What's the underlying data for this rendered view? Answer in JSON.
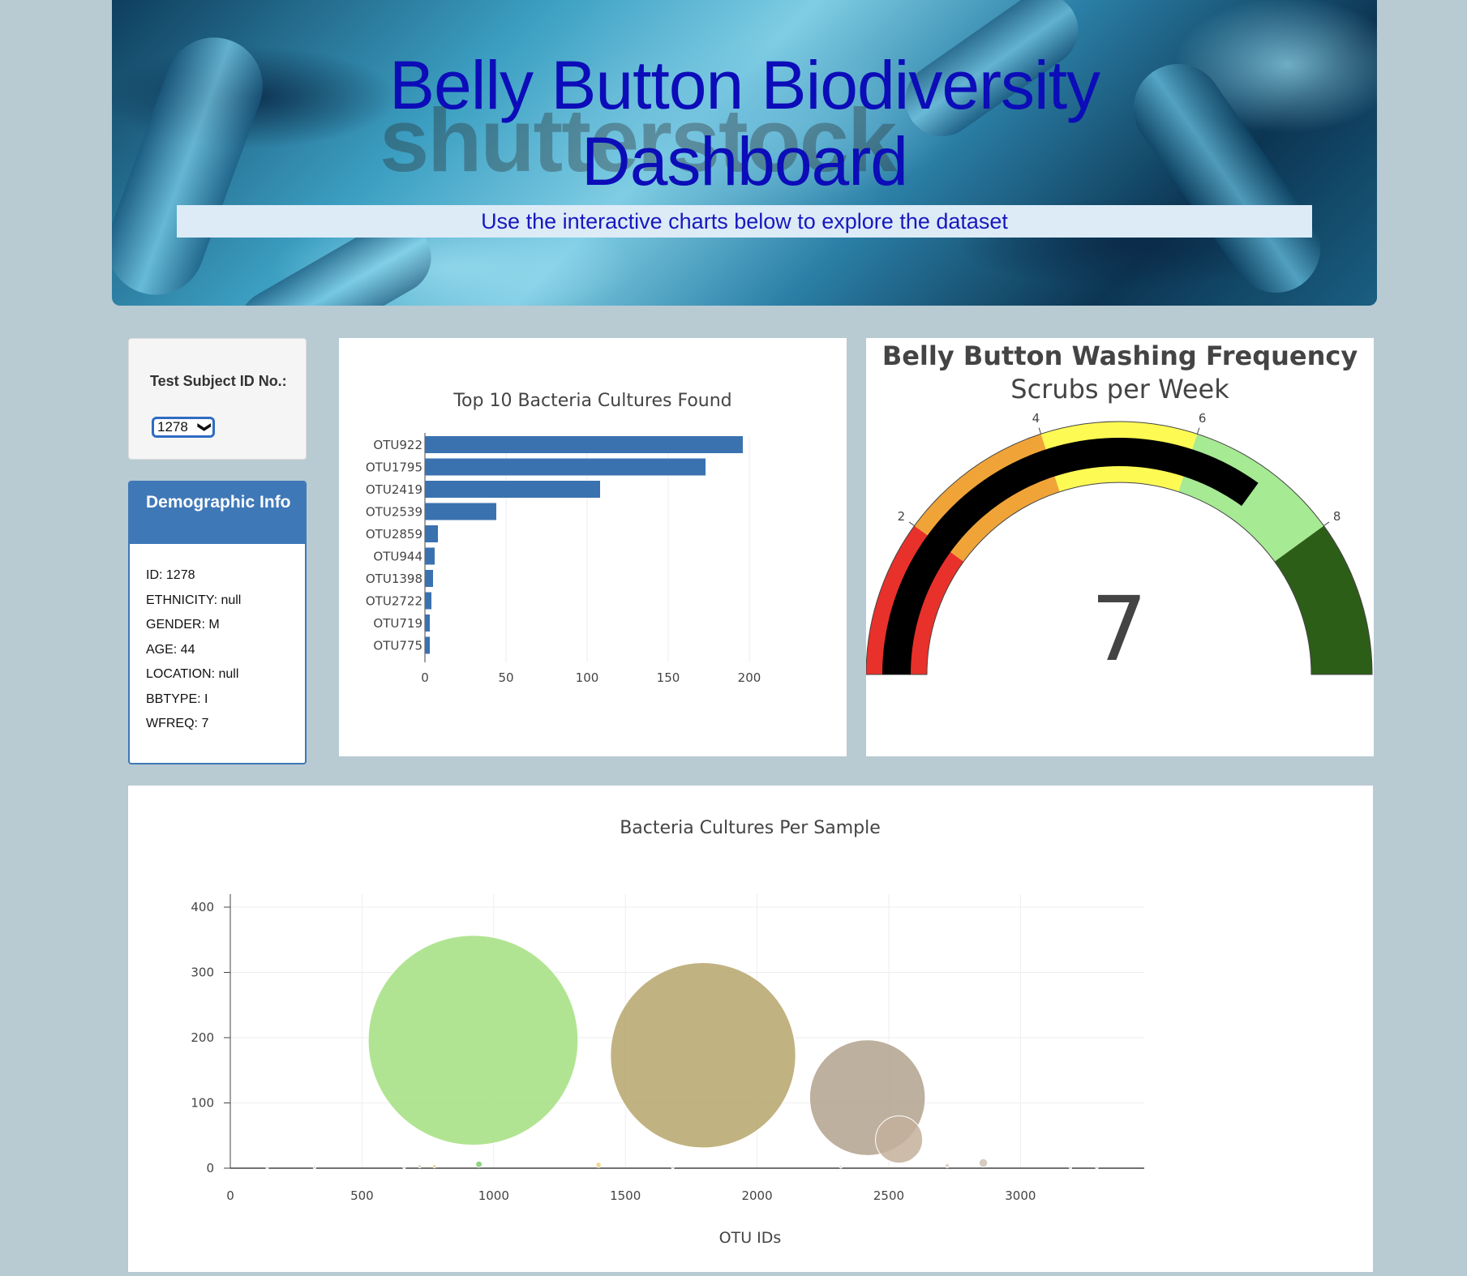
{
  "header": {
    "title_line1": "Belly Button Biodiversity",
    "title_line2": "Dashboard",
    "subtitle": "Use the interactive charts below to explore the dataset",
    "watermark": "shutterstock"
  },
  "selector": {
    "label": "Test Subject ID No.:",
    "selected": "1278",
    "chevron": "❯"
  },
  "demographic": {
    "title": "Demographic Info",
    "rows": [
      "ID: 1278",
      "ETHNICITY: null",
      "GENDER: M",
      "AGE: 44",
      "LOCATION: null",
      "BBTYPE: I",
      "WFREQ: 7"
    ]
  },
  "chart_data": [
    {
      "type": "bar",
      "orientation": "horizontal",
      "title": "Top 10 Bacteria Cultures Found",
      "categories": [
        "OTU922",
        "OTU1795",
        "OTU2419",
        "OTU2539",
        "OTU2859",
        "OTU944",
        "OTU1398",
        "OTU2722",
        "OTU719",
        "OTU775"
      ],
      "values": [
        196,
        173,
        108,
        44,
        8,
        6,
        5,
        4,
        3,
        3
      ],
      "xlim": [
        0,
        210
      ],
      "xticks": [
        0,
        50,
        100,
        150,
        200
      ],
      "color": "#3a72b0",
      "grid": true
    },
    {
      "type": "gauge",
      "title": "Belly Button Washing Frequency",
      "subtitle": "Scrubs per Week",
      "value": 7,
      "range": [
        0,
        10
      ],
      "ticks": [
        2,
        4,
        6,
        8
      ],
      "steps": [
        {
          "range": [
            0,
            2
          ],
          "color": "#e8312a"
        },
        {
          "range": [
            2,
            4
          ],
          "color": "#f0a438"
        },
        {
          "range": [
            4,
            6
          ],
          "color": "#fdfa54"
        },
        {
          "range": [
            6,
            8
          ],
          "color": "#a6ea93"
        },
        {
          "range": [
            8,
            10
          ],
          "color": "#2d5e18"
        }
      ],
      "bar_color": "#000000"
    },
    {
      "type": "scatter",
      "title": "Bacteria Cultures Per Sample",
      "xlabel": "OTU IDs",
      "ylabel": "",
      "xlim": [
        0,
        3470
      ],
      "ylim": [
        -10,
        420
      ],
      "xticks": [
        0,
        500,
        1000,
        1500,
        2000,
        2500,
        3000
      ],
      "yticks": [
        0,
        100,
        200,
        300,
        400
      ],
      "points": [
        {
          "x": 922,
          "y": 196,
          "color": "#a3df7f"
        },
        {
          "x": 1795,
          "y": 173,
          "color": "#b6a46b"
        },
        {
          "x": 2419,
          "y": 108,
          "color": "#b3a28d"
        },
        {
          "x": 2539,
          "y": 44,
          "color": "#c4b09b"
        },
        {
          "x": 2859,
          "y": 8,
          "color": "#cfc3b8"
        },
        {
          "x": 944,
          "y": 6,
          "color": "#7fcb6a"
        },
        {
          "x": 1398,
          "y": 5,
          "color": "#f0d07a"
        },
        {
          "x": 2722,
          "y": 4,
          "color": "#d8cec4"
        },
        {
          "x": 719,
          "y": 3,
          "color": "#d9c9b2"
        },
        {
          "x": 775,
          "y": 3,
          "color": "#f0c26a"
        },
        {
          "x": 140,
          "y": 1,
          "color": "#bcd6c6"
        },
        {
          "x": 320,
          "y": 1,
          "color": "#d0d0d0"
        },
        {
          "x": 660,
          "y": 1,
          "color": "#cfd8d0"
        },
        {
          "x": 1680,
          "y": 1,
          "color": "#d3d3d3"
        },
        {
          "x": 2318,
          "y": 2,
          "color": "#cacaca"
        },
        {
          "x": 3190,
          "y": 1,
          "color": "#d5d5d5"
        },
        {
          "x": 3290,
          "y": 1,
          "color": "#d5d5d5"
        }
      ],
      "grid": true
    }
  ]
}
